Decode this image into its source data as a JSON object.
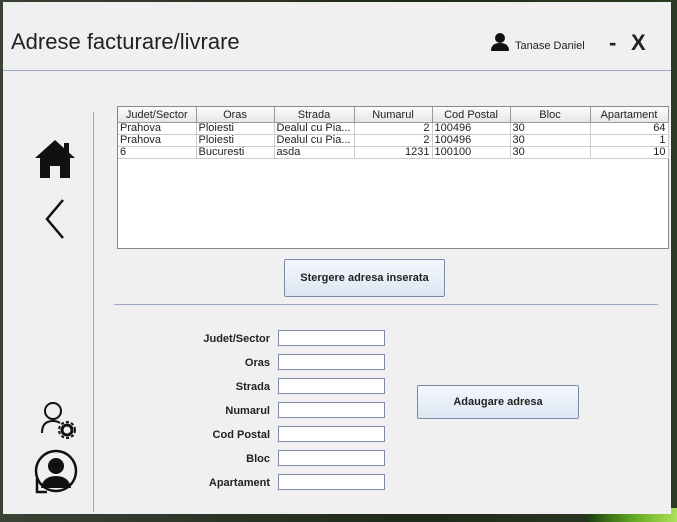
{
  "window": {
    "title": "Adrese facturare/livrare",
    "user_name": "Tanase Daniel",
    "minimize_label": "-",
    "close_label": "X"
  },
  "sidebar": {
    "icons": [
      "home-icon",
      "back-icon",
      "user-settings-icon",
      "logout-user-icon"
    ]
  },
  "table": {
    "columns": [
      "Judet/Sector",
      "Oras",
      "Strada",
      "Numarul",
      "Cod Postal",
      "Bloc",
      "Apartament"
    ],
    "rows": [
      [
        "Prahova",
        "Ploiesti",
        "Dealul cu Pia...",
        "2",
        "100496",
        "30",
        "64"
      ],
      [
        "Prahova",
        "Ploiesti",
        "Dealul cu Pia...",
        "2",
        "100496",
        "30",
        "1"
      ],
      [
        "6",
        "Bucuresti",
        "asda",
        "1231",
        "100100",
        "30",
        "10"
      ]
    ]
  },
  "buttons": {
    "delete_label": "Stergere adresa inserata",
    "add_label": "Adaugare adresa"
  },
  "form": {
    "fields": [
      {
        "label": "Judet/Sector",
        "value": ""
      },
      {
        "label": "Oras",
        "value": ""
      },
      {
        "label": "Strada",
        "value": ""
      },
      {
        "label": "Numarul",
        "value": ""
      },
      {
        "label": "Cod Postal",
        "value": ""
      },
      {
        "label": "Bloc",
        "value": ""
      },
      {
        "label": "Apartament",
        "value": ""
      }
    ]
  }
}
